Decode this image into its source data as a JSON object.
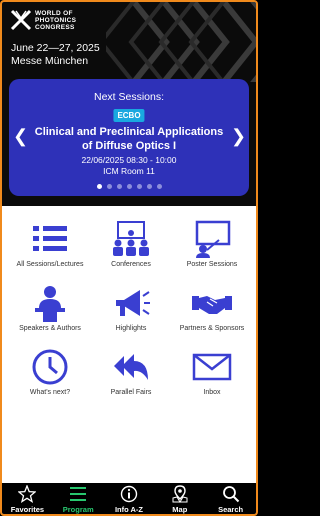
{
  "header": {
    "logo_lines": [
      "WORLD OF",
      "PHOTONICS",
      "CONGRESS"
    ],
    "dates": "June 22—27, 2025",
    "location": "Messe München"
  },
  "next_session": {
    "label": "Next Sessions:",
    "tag": "ECBO",
    "title": "Clinical and Preclinical Applications of Diffuse Optics I",
    "datetime": "22/06/2025 08:30 - 10:00",
    "room": "ICM Room 11",
    "page_count": 7,
    "active_page": 1
  },
  "menu": [
    {
      "label": "All Sessions/Lectures",
      "icon": "list-icon"
    },
    {
      "label": "Conferences",
      "icon": "conference-icon"
    },
    {
      "label": "Poster Sessions",
      "icon": "poster-icon"
    },
    {
      "label": "Speakers & Authors",
      "icon": "speaker-icon"
    },
    {
      "label": "Highlights",
      "icon": "megaphone-icon"
    },
    {
      "label": "Partners & Sponsors",
      "icon": "handshake-icon"
    },
    {
      "label": "What's next?",
      "icon": "clock-icon"
    },
    {
      "label": "Parallel Fairs",
      "icon": "reply-all-icon"
    },
    {
      "label": "Inbox",
      "icon": "envelope-icon"
    }
  ],
  "bottom_nav": [
    {
      "label": "Favorites",
      "icon": "star-icon"
    },
    {
      "label": "Program",
      "icon": "hamburger-icon",
      "active": true
    },
    {
      "label": "Info A-Z",
      "icon": "info-icon"
    },
    {
      "label": "Map",
      "icon": "map-pin-icon"
    },
    {
      "label": "Search",
      "icon": "search-icon"
    }
  ],
  "colors": {
    "brand_blue": "#3a3fd1",
    "card_blue": "#2e31b8",
    "tag_cyan": "#19a8e0",
    "active_green": "#28c76f",
    "frame_orange": "#f08a1c"
  }
}
